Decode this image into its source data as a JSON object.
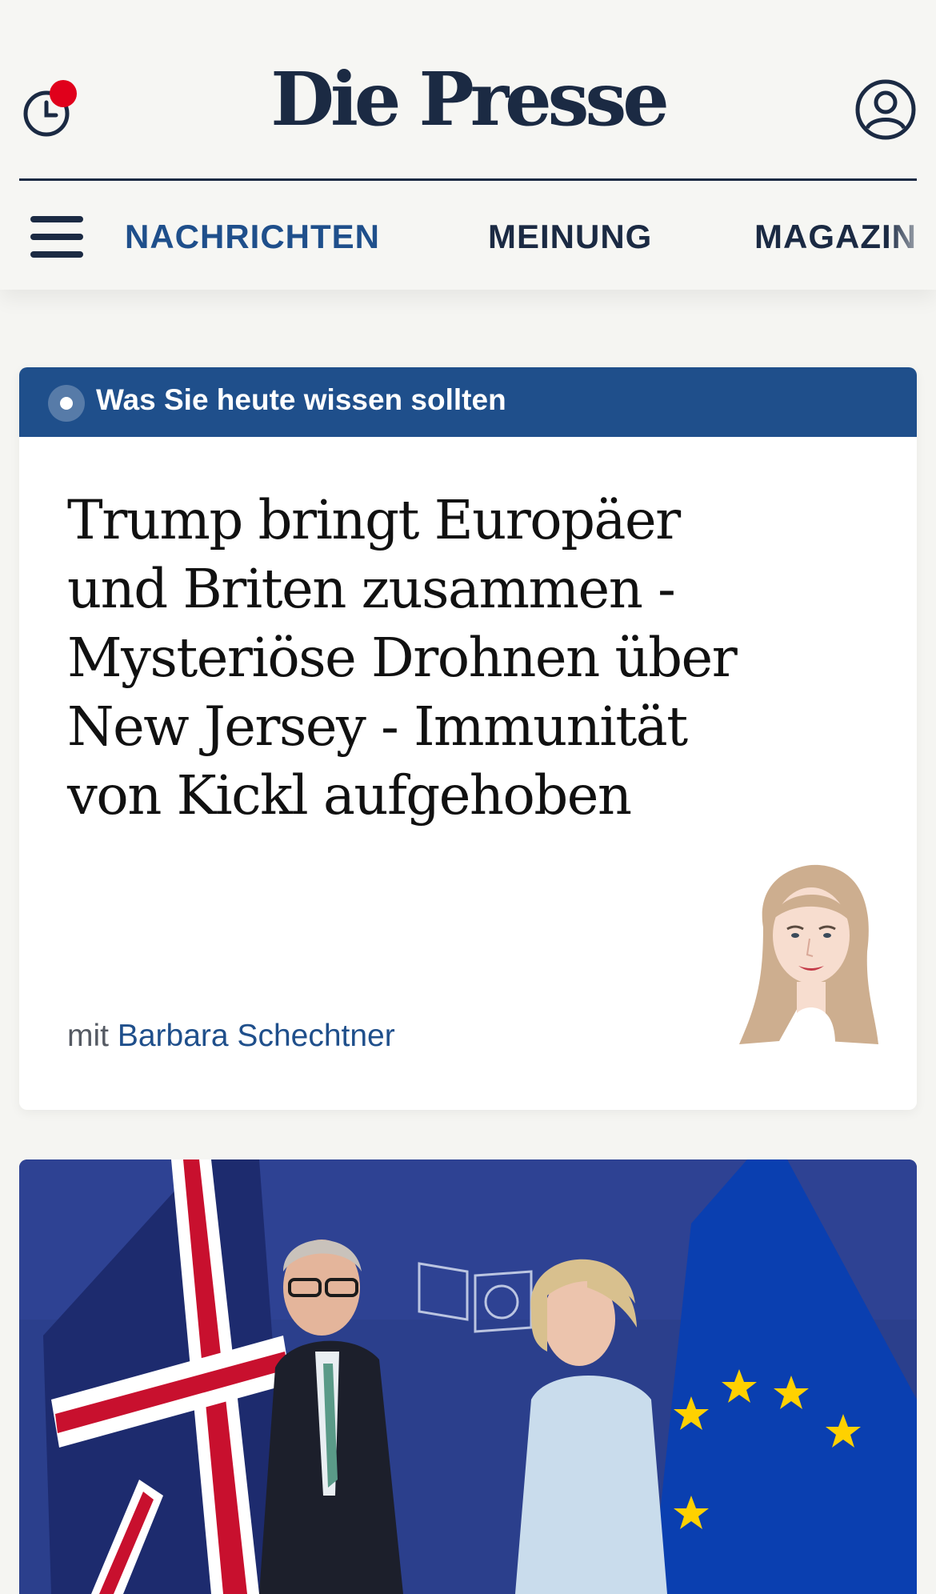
{
  "header": {
    "logo_text": "Die Presse",
    "history_icon": "clock-icon",
    "account_icon": "user-icon",
    "notification_color": "#e0001b"
  },
  "nav": {
    "menu_icon": "hamburger-menu-icon",
    "items": [
      {
        "label": "NACHRICHTEN",
        "active": true
      },
      {
        "label": "MEINUNG",
        "active": false
      },
      {
        "label": "MAGAZIN",
        "active": false
      }
    ]
  },
  "briefing": {
    "bar_label": "Was Sie heute wissen sollten",
    "title": "Trump bringt Europäer und Briten zusammen - Mysteriöse Drohnen über New Jersey - Immunität von Kickl aufgehoben",
    "byline_prefix": "mit",
    "author": "Barbara Schechtner"
  },
  "hero": {
    "image_icon": "article-photo"
  },
  "colors": {
    "brand_navy": "#1b2a43",
    "accent_blue": "#1f4f8b",
    "background": "#f5f5f2"
  }
}
